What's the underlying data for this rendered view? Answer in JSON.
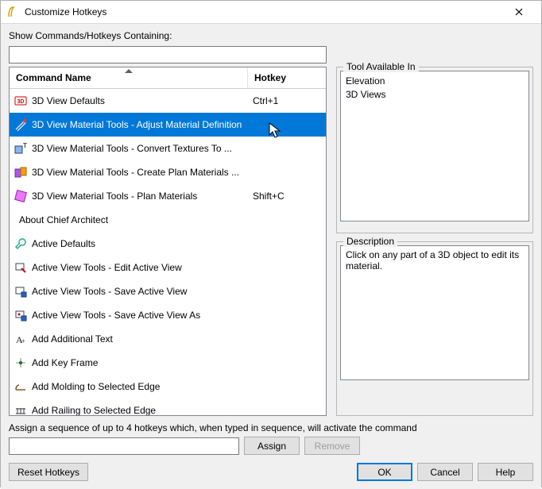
{
  "window": {
    "title": "Customize Hotkeys"
  },
  "filter": {
    "label": "Show Commands/Hotkeys Containing:",
    "value": ""
  },
  "grid": {
    "headers": {
      "name": "Command Name",
      "hotkey": "Hotkey"
    },
    "rows": [
      {
        "icon": "3d-icon",
        "name": "3D View Defaults",
        "hotkey": "Ctrl+1",
        "selected": false
      },
      {
        "icon": "material-adjust-icon",
        "name": "3D View Material Tools - Adjust Material Definition",
        "hotkey": "",
        "selected": true
      },
      {
        "icon": "material-convert-icon",
        "name": "3D View Material Tools - Convert Textures To ...",
        "hotkey": "",
        "selected": false
      },
      {
        "icon": "material-create-icon",
        "name": "3D View Material Tools - Create Plan Materials ...",
        "hotkey": "",
        "selected": false
      },
      {
        "icon": "material-plan-icon",
        "name": "3D View Material Tools - Plan Materials",
        "hotkey": "Shift+C",
        "selected": false
      },
      {
        "icon": "none",
        "name": "About Chief Architect",
        "hotkey": "",
        "selected": false
      },
      {
        "icon": "wrench-icon",
        "name": "Active Defaults",
        "hotkey": "",
        "selected": false
      },
      {
        "icon": "view-edit-icon",
        "name": "Active View Tools - Edit Active View",
        "hotkey": "",
        "selected": false
      },
      {
        "icon": "view-save-icon",
        "name": "Active View Tools - Save Active View",
        "hotkey": "",
        "selected": false
      },
      {
        "icon": "view-saveas-icon",
        "name": "Active View Tools - Save Active View As",
        "hotkey": "",
        "selected": false
      },
      {
        "icon": "text-icon",
        "name": "Add Additional Text",
        "hotkey": "",
        "selected": false
      },
      {
        "icon": "keyframe-icon",
        "name": "Add Key Frame",
        "hotkey": "",
        "selected": false
      },
      {
        "icon": "molding-icon",
        "name": "Add Molding to Selected Edge",
        "hotkey": "",
        "selected": false
      },
      {
        "icon": "railing-icon",
        "name": "Add Railing to Selected Edge",
        "hotkey": "",
        "selected": false
      }
    ]
  },
  "toolAvailable": {
    "legend": "Tool Available In",
    "lines": [
      "Elevation",
      "3D Views"
    ]
  },
  "description": {
    "legend": "Description",
    "text": "Click on any part of a 3D object to edit its material."
  },
  "assign": {
    "label": "Assign a sequence of up to 4 hotkeys which, when typed in sequence, will activate the command",
    "value": "",
    "assign_label": "Assign",
    "remove_label": "Remove"
  },
  "buttons": {
    "reset": "Reset Hotkeys",
    "ok": "OK",
    "cancel": "Cancel",
    "help": "Help"
  }
}
